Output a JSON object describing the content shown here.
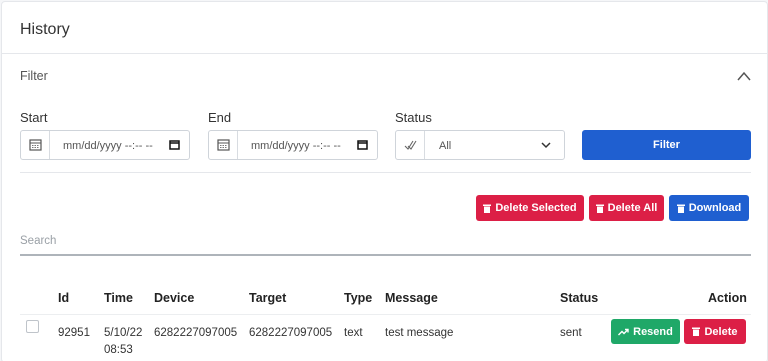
{
  "header": {
    "title": "History"
  },
  "filter": {
    "title": "Filter",
    "start_label": "Start",
    "start_placeholder": "mm/dd/yyyy --:-- --",
    "end_label": "End",
    "end_placeholder": "mm/dd/yyyy --:-- --",
    "status_label": "Status",
    "status_value": "All",
    "filter_button": "Filter"
  },
  "actions": {
    "delete_selected": "Delete Selected",
    "delete_all": "Delete All",
    "download": "Download"
  },
  "search": {
    "placeholder": "Search"
  },
  "table": {
    "headers": {
      "id": "Id",
      "time": "Time",
      "device": "Device",
      "target": "Target",
      "type": "Type",
      "message": "Message",
      "status": "Status",
      "action": "Action"
    },
    "rows": [
      {
        "id": "92951",
        "time_date": "5/10/22",
        "time_clock": "08:53",
        "device": "6282227097005",
        "target": "6282227097005",
        "type": "text",
        "message": "test message",
        "status": "sent",
        "resend": "Resend",
        "delete": "Delete"
      }
    ]
  },
  "colors": {
    "primary": "#1f5fd0",
    "danger": "#dc1f46",
    "success": "#1fa868"
  },
  "icons": {
    "calendar": "calendar-icon",
    "check": "check-icon",
    "trash": "trash-icon",
    "resend": "resend-icon",
    "chevron": "chevron-up-icon"
  }
}
